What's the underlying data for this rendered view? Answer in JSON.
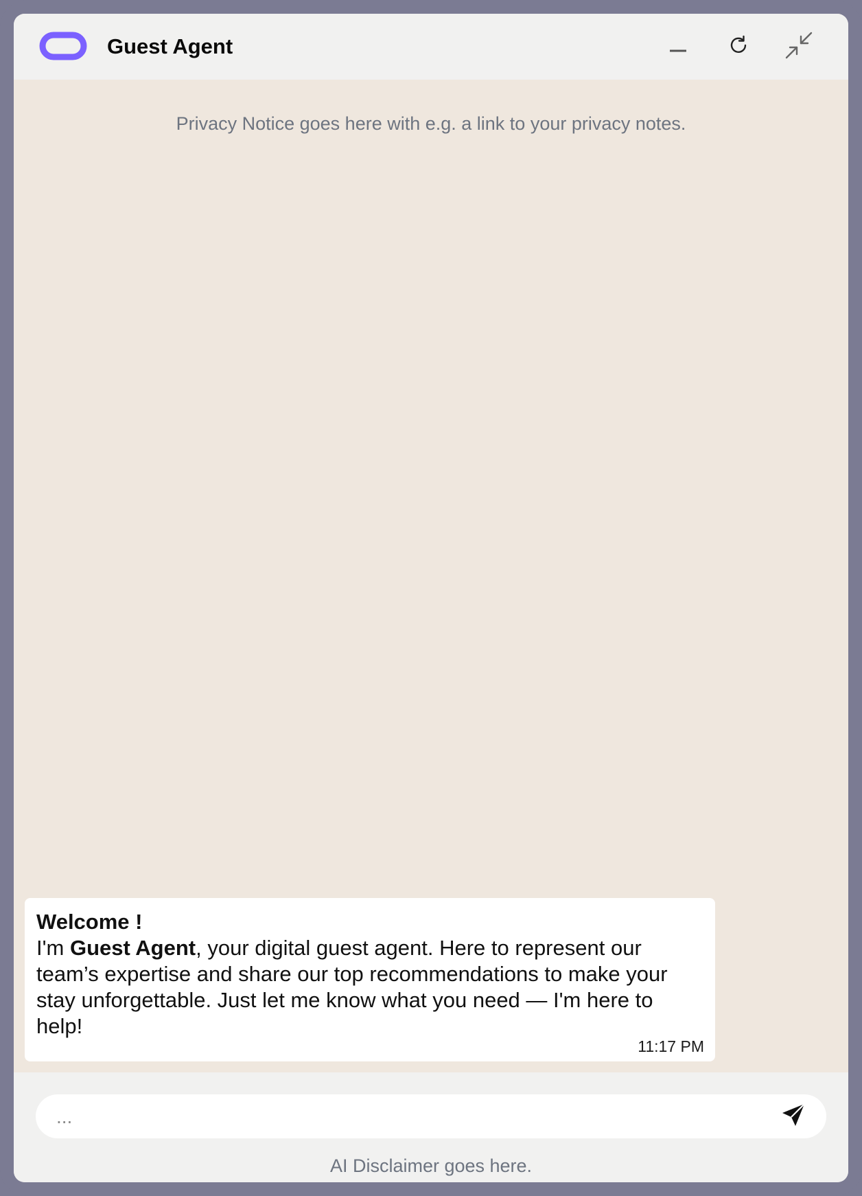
{
  "header": {
    "title": "Guest Agent",
    "logo_icon": "chain-link-icon",
    "actions": {
      "minimize_icon": "minimize-icon",
      "reload_icon": "reload-icon",
      "collapse_icon": "collapse-arrows-icon"
    }
  },
  "privacy_notice": "Privacy Notice goes here with e.g. a link to your privacy notes.",
  "messages": [
    {
      "sender": "agent",
      "title": "Welcome !",
      "text_prefix": "I'm ",
      "text_bold": "Guest Agent",
      "text_suffix": ", your digital guest agent. Here to represent our team’s expertise and share our top recommendations to make your stay unforgettable. Just let me know what you need — I'm here to help!",
      "time": "11:17 PM"
    }
  ],
  "composer": {
    "placeholder": "...",
    "value": "",
    "send_icon": "send-icon"
  },
  "ai_disclaimer": "AI Disclaimer goes here.",
  "colors": {
    "frame": "#7b7b93",
    "header_bg": "#f1f1f0",
    "chat_bg": "#efe7de",
    "brand": "#7b61ff",
    "muted_text": "#6d7480"
  }
}
